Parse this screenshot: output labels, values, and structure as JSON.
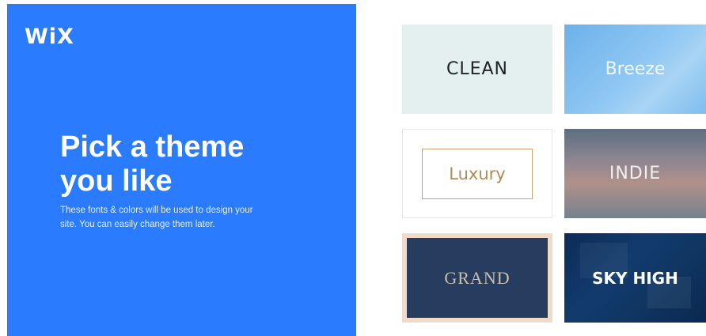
{
  "brand": {
    "logo": "WiX"
  },
  "intro": {
    "headline_line1": "Pick a theme",
    "headline_line2": "you like",
    "description_line1": "These fonts & colors will be used to design your",
    "description_line2": "site. You can easily change them later."
  },
  "themes": [
    {
      "label": "CLEAN",
      "colors": [
        "#e4eff0",
        "#222222"
      ]
    },
    {
      "label": "Breeze",
      "colors": [
        "#7fbdee",
        "#f2f8ff"
      ]
    },
    {
      "label": "Luxury",
      "colors": [
        "#ffffff",
        "#b08a55"
      ]
    },
    {
      "label": "INDIE",
      "colors": [
        "#8d8590",
        "#eef1f4"
      ]
    },
    {
      "label": "GRAND",
      "colors": [
        "#f0dbc9",
        "#273d5f",
        "#cdbfa9"
      ]
    },
    {
      "label": "SKY HIGH",
      "colors": [
        "#0f345f",
        "#ffffff"
      ]
    }
  ],
  "colors": {
    "panel": "#2b7bff"
  }
}
